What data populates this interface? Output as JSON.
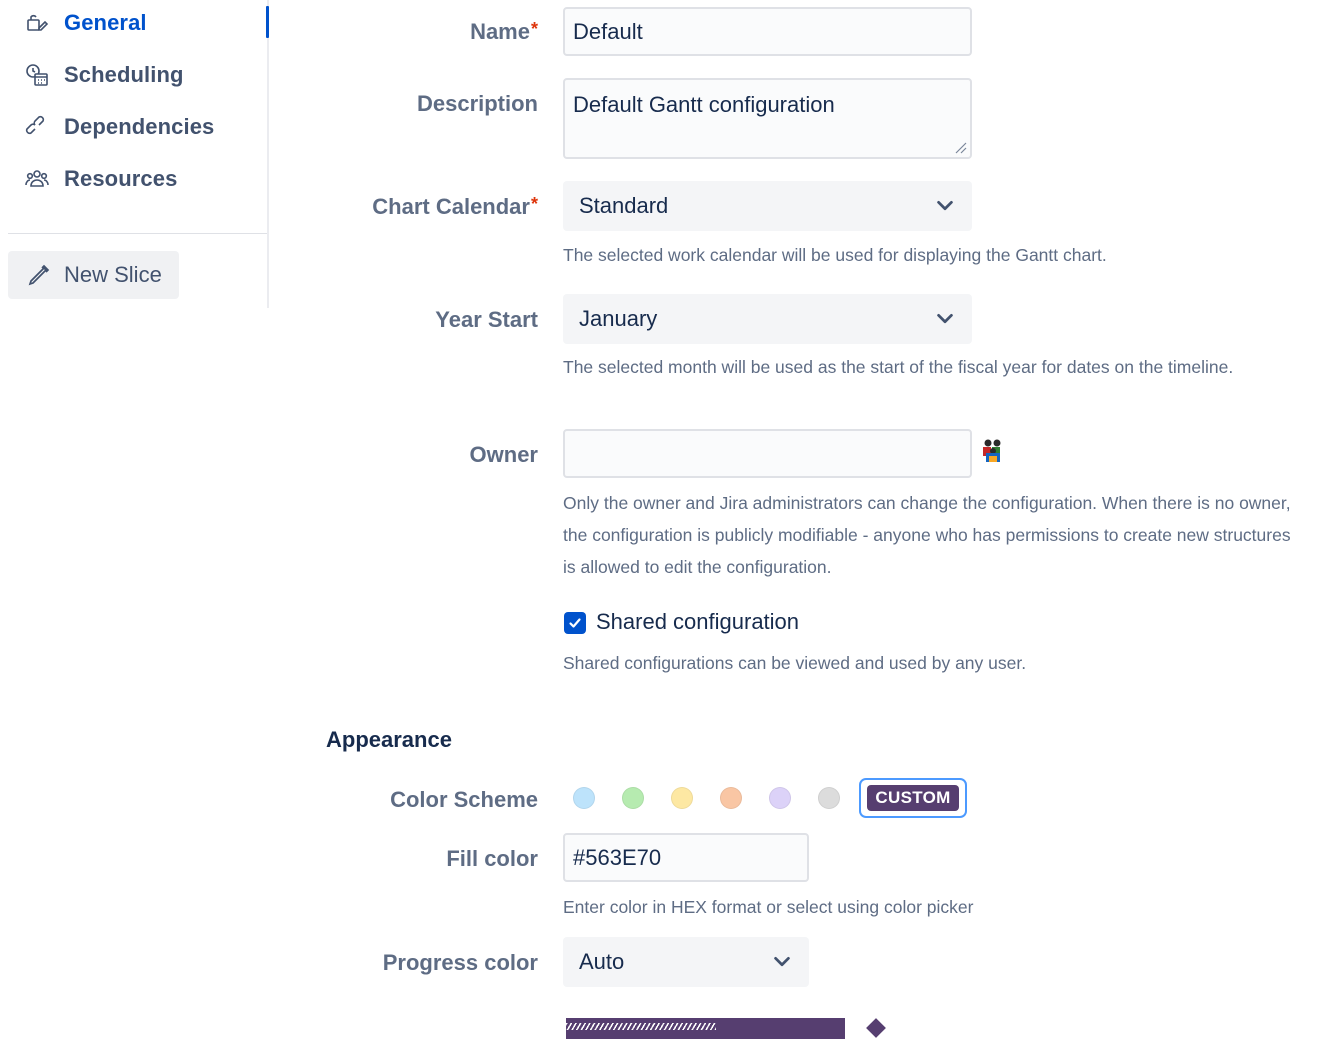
{
  "sidebar": {
    "items": [
      {
        "label": "General",
        "icon": "general-settings-icon",
        "active": true
      },
      {
        "label": "Scheduling",
        "icon": "calendar-clock-icon",
        "active": false
      },
      {
        "label": "Dependencies",
        "icon": "link-icon",
        "active": false
      },
      {
        "label": "Resources",
        "icon": "people-icon",
        "active": false
      }
    ],
    "new_slice": {
      "label": "New Slice",
      "icon": "pen-icon"
    }
  },
  "form": {
    "name": {
      "label": "Name",
      "required": "*",
      "value": "Default"
    },
    "description": {
      "label": "Description",
      "value": "Default Gantt configuration"
    },
    "chart_calendar": {
      "label": "Chart Calendar",
      "required": "*",
      "value": "Standard",
      "help": "The selected work calendar will be used for displaying the Gantt chart."
    },
    "year_start": {
      "label": "Year Start",
      "value": "January",
      "help": "The selected month will be used as the start of the fiscal year for dates on the timeline."
    },
    "owner": {
      "label": "Owner",
      "value": "",
      "help_line1": "Only the owner and Jira administrators can change the configuration. When there is no owner,",
      "help_line2": "the configuration is publicly modifiable - anyone who has permissions to create new structures",
      "help_line3": "is allowed to edit the configuration."
    },
    "shared": {
      "label": "Shared configuration",
      "checked": true,
      "help": "Shared configurations can be viewed and used by any user."
    }
  },
  "appearance": {
    "title": "Appearance",
    "color_scheme": {
      "label": "Color Scheme",
      "swatches": [
        "#bde3fb",
        "#b6ebb0",
        "#fde8a3",
        "#f9c6a4",
        "#dcd2f8",
        "#dcdcdc"
      ],
      "custom_label": "CUSTOM"
    },
    "fill_color": {
      "label": "Fill color",
      "value": "#563E70",
      "help": "Enter color in HEX format or select using color picker"
    },
    "progress_color": {
      "label": "Progress color",
      "value": "Auto"
    }
  },
  "colors": {
    "accent": "#0052cc",
    "custom_fill": "#563e70",
    "required": "#de350b"
  }
}
